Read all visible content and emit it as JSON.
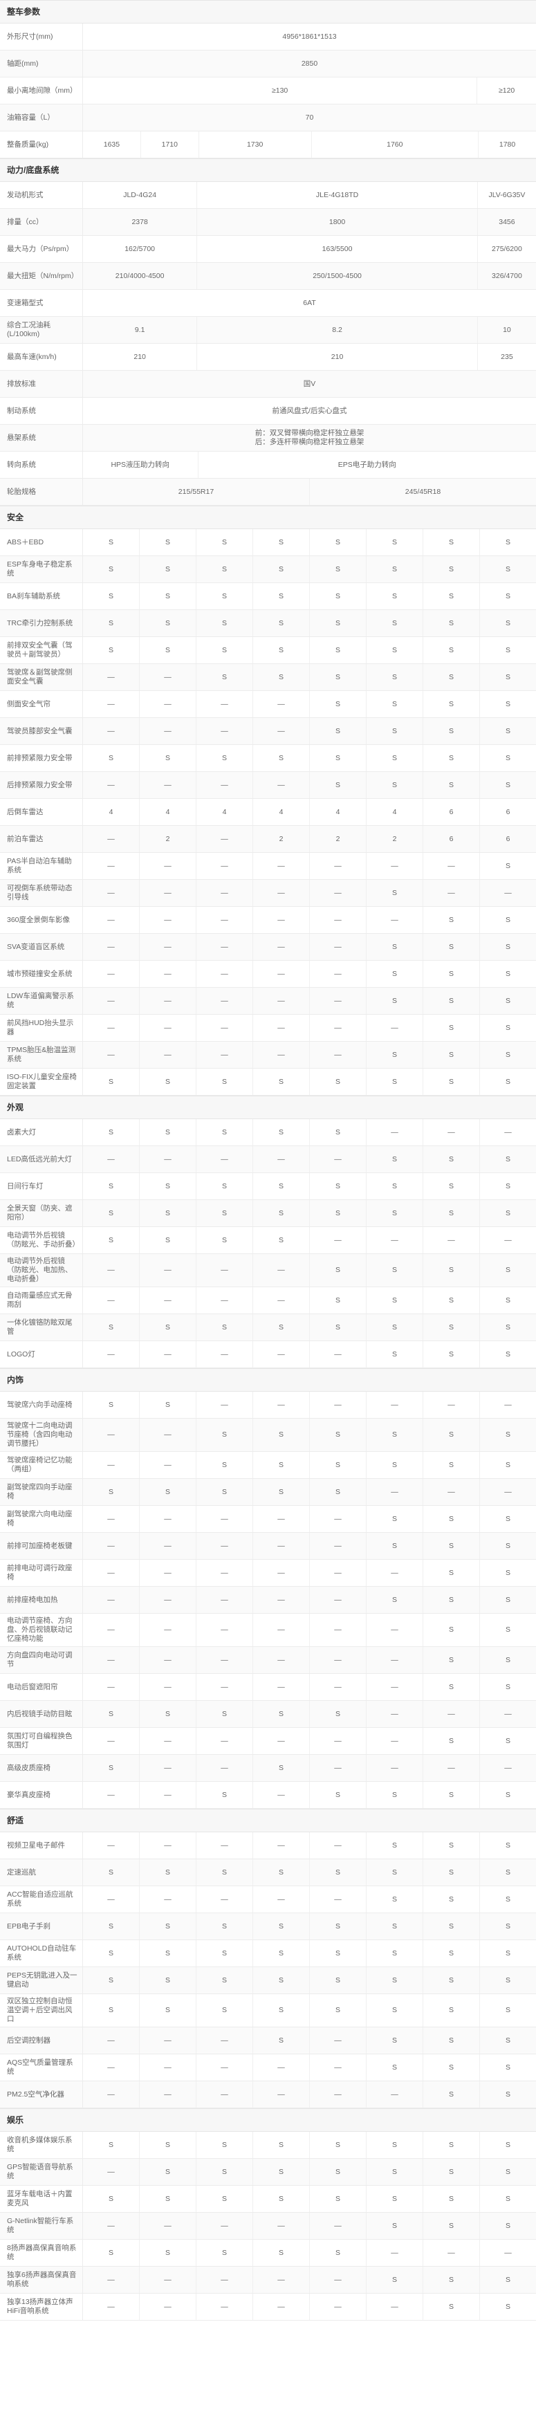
{
  "sections": [
    {
      "title": "整车参数",
      "rows": [
        {
          "label": "外形尺寸(mm)",
          "cells": [
            {
              "t": "4956*1861*1513",
              "s": 8
            }
          ]
        },
        {
          "label": "轴距(mm)",
          "cells": [
            {
              "t": "2850",
              "s": 8
            }
          ]
        },
        {
          "label": "最小离地间隙（mm）",
          "cells": [
            {
              "t": "≥130",
              "s": 7
            },
            {
              "t": "≥120",
              "s": 1
            }
          ]
        },
        {
          "label": "油箱容量（L）",
          "cells": [
            {
              "t": "70",
              "s": 8
            }
          ]
        },
        {
          "label": "整备质量(kg)",
          "cells": [
            {
              "t": "1635",
              "s": 1
            },
            {
              "t": "1710",
              "s": 1
            },
            {
              "t": "1730",
              "s": 2
            },
            {
              "t": "1760",
              "s": 3
            },
            {
              "t": "1780",
              "s": 1
            }
          ]
        }
      ]
    },
    {
      "title": "动力/底盘系统",
      "rows": [
        {
          "label": "发动机形式",
          "cells": [
            {
              "t": "JLD-4G24",
              "s": 2
            },
            {
              "t": "JLE-4G18TD",
              "s": 5
            },
            {
              "t": "JLV-6G35V",
              "s": 1
            }
          ]
        },
        {
          "label": "排量（cc）",
          "cells": [
            {
              "t": "2378",
              "s": 2
            },
            {
              "t": "1800",
              "s": 5
            },
            {
              "t": "3456",
              "s": 1
            }
          ]
        },
        {
          "label": "最大马力（Ps/rpm）",
          "cells": [
            {
              "t": "162/5700",
              "s": 2
            },
            {
              "t": "163/5500",
              "s": 5
            },
            {
              "t": "275/6200",
              "s": 1
            }
          ]
        },
        {
          "label": "最大扭矩（N/m/rpm）",
          "cells": [
            {
              "t": "210/4000-4500",
              "s": 2
            },
            {
              "t": "250/1500-4500",
              "s": 5
            },
            {
              "t": "326/4700",
              "s": 1
            }
          ]
        },
        {
          "label": "变速箱型式",
          "cells": [
            {
              "t": "6AT",
              "s": 8
            }
          ]
        },
        {
          "label": "综合工况油耗(L/100km)",
          "cells": [
            {
              "t": "9.1",
              "s": 2
            },
            {
              "t": "8.2",
              "s": 5
            },
            {
              "t": "10",
              "s": 1
            }
          ]
        },
        {
          "label": "最高车速(km/h)",
          "cells": [
            {
              "t": "210",
              "s": 2
            },
            {
              "t": "210",
              "s": 5
            },
            {
              "t": "235",
              "s": 1
            }
          ]
        },
        {
          "label": "排放标准",
          "cells": [
            {
              "t": "国V",
              "s": 8
            }
          ]
        },
        {
          "label": "制动系统",
          "cells": [
            {
              "t": "前通风盘式/后实心盘式",
              "s": 8
            }
          ]
        },
        {
          "label": "悬架系统",
          "cells": [
            {
              "t": "前：双叉臂带横向稳定杆独立悬架\n后：多连杆带横向稳定杆独立悬架",
              "s": 8
            }
          ]
        },
        {
          "label": "转向系统",
          "cells": [
            {
              "t": "HPS液压助力转向",
              "s": 2
            },
            {
              "t": "EPS电子助力转向",
              "s": 6
            }
          ]
        },
        {
          "label": "轮胎规格",
          "cells": [
            {
              "t": "215/55R17",
              "s": 4
            },
            {
              "t": "245/45R18",
              "s": 4
            }
          ]
        }
      ]
    },
    {
      "title": "安全",
      "rows": [
        {
          "label": "ABS＋EBD",
          "v": "SSSSSSSS"
        },
        {
          "label": "ESP车身电子稳定系统",
          "v": "SSSSSSSS"
        },
        {
          "label": "BA刹车辅助系统",
          "v": "SSSSSSSS"
        },
        {
          "label": "TRC牵引力控制系统",
          "v": "SSSSSSSS"
        },
        {
          "label": "前排双安全气囊（驾驶员＋副驾驶员）",
          "v": "SSSSSSSS"
        },
        {
          "label": "驾驶席＆副驾驶席侧面安全气囊",
          "v": "——SSSSSS"
        },
        {
          "label": "侧面安全气帘",
          "v": "————SSSS"
        },
        {
          "label": "驾驶员膝部安全气囊",
          "v": "————SSSS"
        },
        {
          "label": "前排预紧限力安全带",
          "v": "SSSSSSSS"
        },
        {
          "label": "后排预紧限力安全带",
          "v": "————SSSS"
        },
        {
          "label": "后倒车雷达",
          "v": "44444466"
        },
        {
          "label": "前泊车雷达",
          "v": "—2—22266"
        },
        {
          "label": "PAS半自动泊车辅助系统",
          "v": "———————S"
        },
        {
          "label": "可视倒车系统带动态引导线",
          "v": "—————S——"
        },
        {
          "label": "360度全景倒车影像",
          "v": "——————SS"
        },
        {
          "label": "SVA变道盲区系统",
          "v": "—————SSS"
        },
        {
          "label": "城市预碰撞安全系统",
          "v": "—————SSS"
        },
        {
          "label": "LDW车道偏离警示系统",
          "v": "—————SSS"
        },
        {
          "label": "前风挡HUD抬头显示器",
          "v": "——————SS"
        },
        {
          "label": "TPMS胎压&胎温监测系统",
          "v": "—————SSS"
        },
        {
          "label": "ISO-FIX儿童安全座椅固定装置",
          "v": "SSSSSSSS"
        }
      ]
    },
    {
      "title": "外观",
      "rows": [
        {
          "label": "卤素大灯",
          "v": "SSSSS———"
        },
        {
          "label": "LED高低远光前大灯",
          "v": "—————SSS"
        },
        {
          "label": "日间行车灯",
          "v": "SSSSSSSS"
        },
        {
          "label": "全景天窗（防夹、遮阳帘）",
          "v": "SSSSSSSS"
        },
        {
          "label": "电动调节外后视镜（防眩光、手动折叠）",
          "v": "SSSS————"
        },
        {
          "label": "电动调节外后视镜（防眩光、电加热、电动折叠）",
          "v": "————SSSS"
        },
        {
          "label": "自动雨量感应式无骨雨刮",
          "v": "————SSSS"
        },
        {
          "label": "一体化镀铬防眩双尾管",
          "v": "SSSSSSSS"
        },
        {
          "label": "LOGO灯",
          "v": "—————SSS"
        }
      ]
    },
    {
      "title": "内饰",
      "rows": [
        {
          "label": "驾驶席六向手动座椅",
          "v": "SS——————"
        },
        {
          "label": "驾驶席十二向电动调节座椅（含四向电动调节腰托）",
          "v": "——SSSSSS"
        },
        {
          "label": "驾驶席座椅记忆功能（两组）",
          "v": "——SSSSSS"
        },
        {
          "label": "副驾驶席四向手动座椅",
          "v": "SSSSS———"
        },
        {
          "label": "副驾驶席六向电动座椅",
          "v": "—————SSS"
        },
        {
          "label": "前排可加座椅老板键",
          "v": "—————SSS"
        },
        {
          "label": "前排电动可调行政座椅",
          "v": "——————SS"
        },
        {
          "label": "前排座椅电加热",
          "v": "—————SSS"
        },
        {
          "label": "电动调节座椅、方向盘、外后视镜联动记忆座椅功能",
          "v": "——————SS"
        },
        {
          "label": "方向盘四向电动可调节",
          "v": "——————SS"
        },
        {
          "label": "电动后窗遮阳帘",
          "v": "——————SS"
        },
        {
          "label": "内后视镜手动防目眩",
          "v": "SSSSS———"
        },
        {
          "label": "氛围灯可自编程换色氛围灯",
          "v": "——————SS"
        },
        {
          "label": "高级皮质座椅",
          "v": "S——S————"
        },
        {
          "label": "豪华真皮座椅",
          "v": "——S—SSSS"
        }
      ]
    },
    {
      "title": "舒适",
      "rows": [
        {
          "label": "视频卫星电子邮件",
          "v": "—————SSS"
        },
        {
          "label": "定速巡航",
          "v": "SSSSSSSS"
        },
        {
          "label": "ACC智能自适应巡航系统",
          "v": "—————SSS"
        },
        {
          "label": "EPB电子手刹",
          "v": "SSSSSSSS"
        },
        {
          "label": "AUTOHOLD自动驻车系统",
          "v": "SSSSSSSS"
        },
        {
          "label": "PEPS无钥匙进入及一键启动",
          "v": "SSSSSSSS"
        },
        {
          "label": "双区独立控制自动恒温空调＋后空调出风口",
          "v": "SSSSSSSS"
        },
        {
          "label": "后空调控制器",
          "v": "———S—SSS"
        },
        {
          "label": "AQS空气质量管理系统",
          "v": "—————SSS"
        },
        {
          "label": "PM2.5空气净化器",
          "v": "——————SS"
        }
      ]
    },
    {
      "title": "娱乐",
      "rows": [
        {
          "label": "收音机多媒体娱乐系统",
          "v": "SSSSSSSS"
        },
        {
          "label": "GPS智能语音导航系统",
          "v": "—SSSSSSS"
        },
        {
          "label": "蓝牙车载电话＋内置麦克风",
          "v": "SSSSSSSS"
        },
        {
          "label": "G-Netlink智能行车系统",
          "v": "—————SSS"
        },
        {
          "label": "8扬声器高保真音响系统",
          "v": "SSSSS———"
        },
        {
          "label": "独享6扬声器高保真音响系统",
          "v": "—————SSS"
        },
        {
          "label": "独享13扬声器立体声HiFi音响系统",
          "v": "——————SS"
        }
      ]
    }
  ]
}
